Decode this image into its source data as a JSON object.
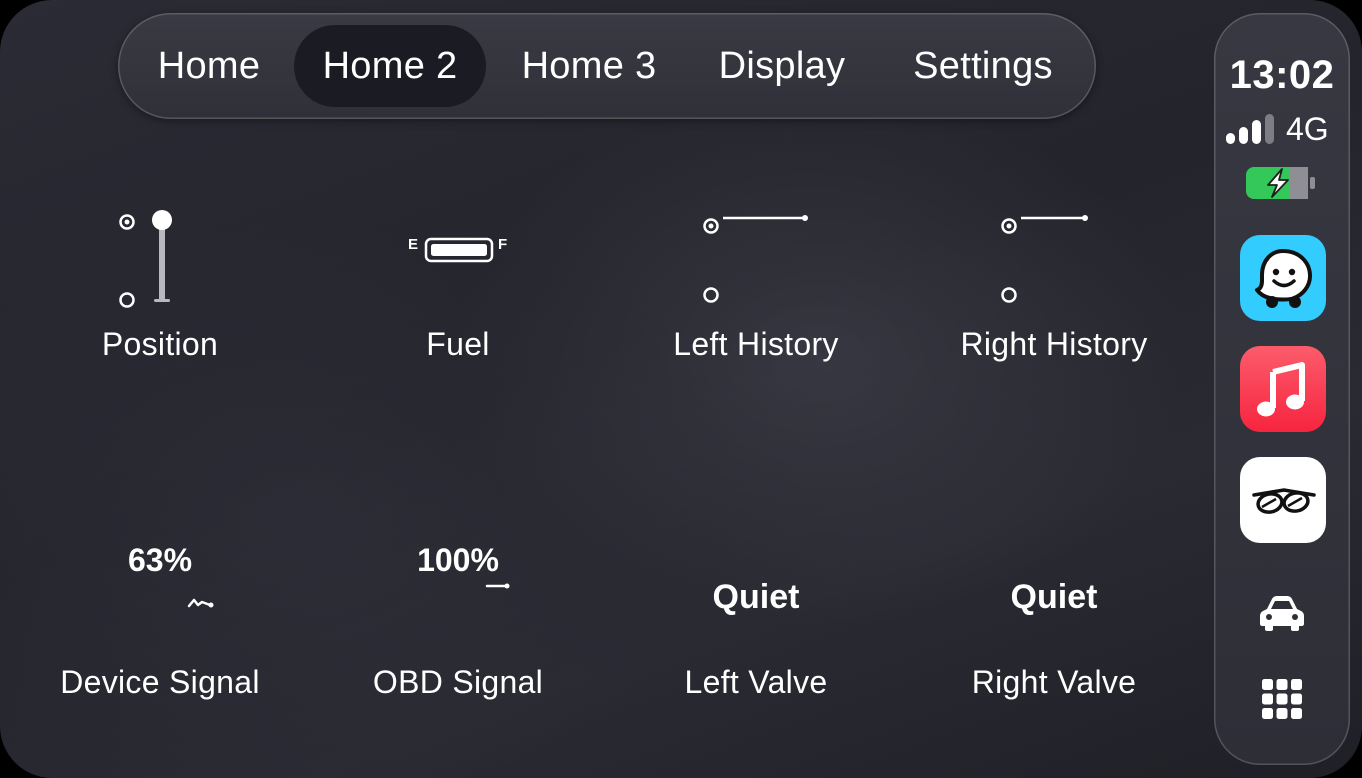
{
  "tabs": [
    {
      "label": "Home",
      "active": false
    },
    {
      "label": "Home 2",
      "active": true
    },
    {
      "label": "Home 3",
      "active": false
    },
    {
      "label": "Display",
      "active": false
    },
    {
      "label": "Settings",
      "active": false
    }
  ],
  "status": {
    "time": "13:02",
    "network": "4G",
    "signal_bars": 3,
    "battery_charging": true
  },
  "apps": [
    {
      "name": "Waze",
      "icon": "waze-icon"
    },
    {
      "name": "Music",
      "icon": "music-note-icon"
    },
    {
      "name": "Exhaust app",
      "icon": "exhaust-logo-icon"
    }
  ],
  "widgets": {
    "position": {
      "label": "Position"
    },
    "fuel": {
      "label": "Fuel",
      "empty": "E",
      "full": "F",
      "level": 1.0
    },
    "left_history": {
      "label": "Left History"
    },
    "right_history": {
      "label": "Right History"
    },
    "device_signal": {
      "label": "Device Signal",
      "value": "63%"
    },
    "obd_signal": {
      "label": "OBD Signal",
      "value": "100%"
    },
    "left_valve": {
      "label": "Left Valve",
      "value": "Quiet"
    },
    "right_valve": {
      "label": "Right Valve",
      "value": "Quiet"
    }
  },
  "colors": {
    "background": "#26262e",
    "text": "#ffffff",
    "active_tab": "#1b1b23",
    "battery_green": "#34c759",
    "waze_blue": "#33ccff",
    "music_red": "#fa2d48"
  }
}
